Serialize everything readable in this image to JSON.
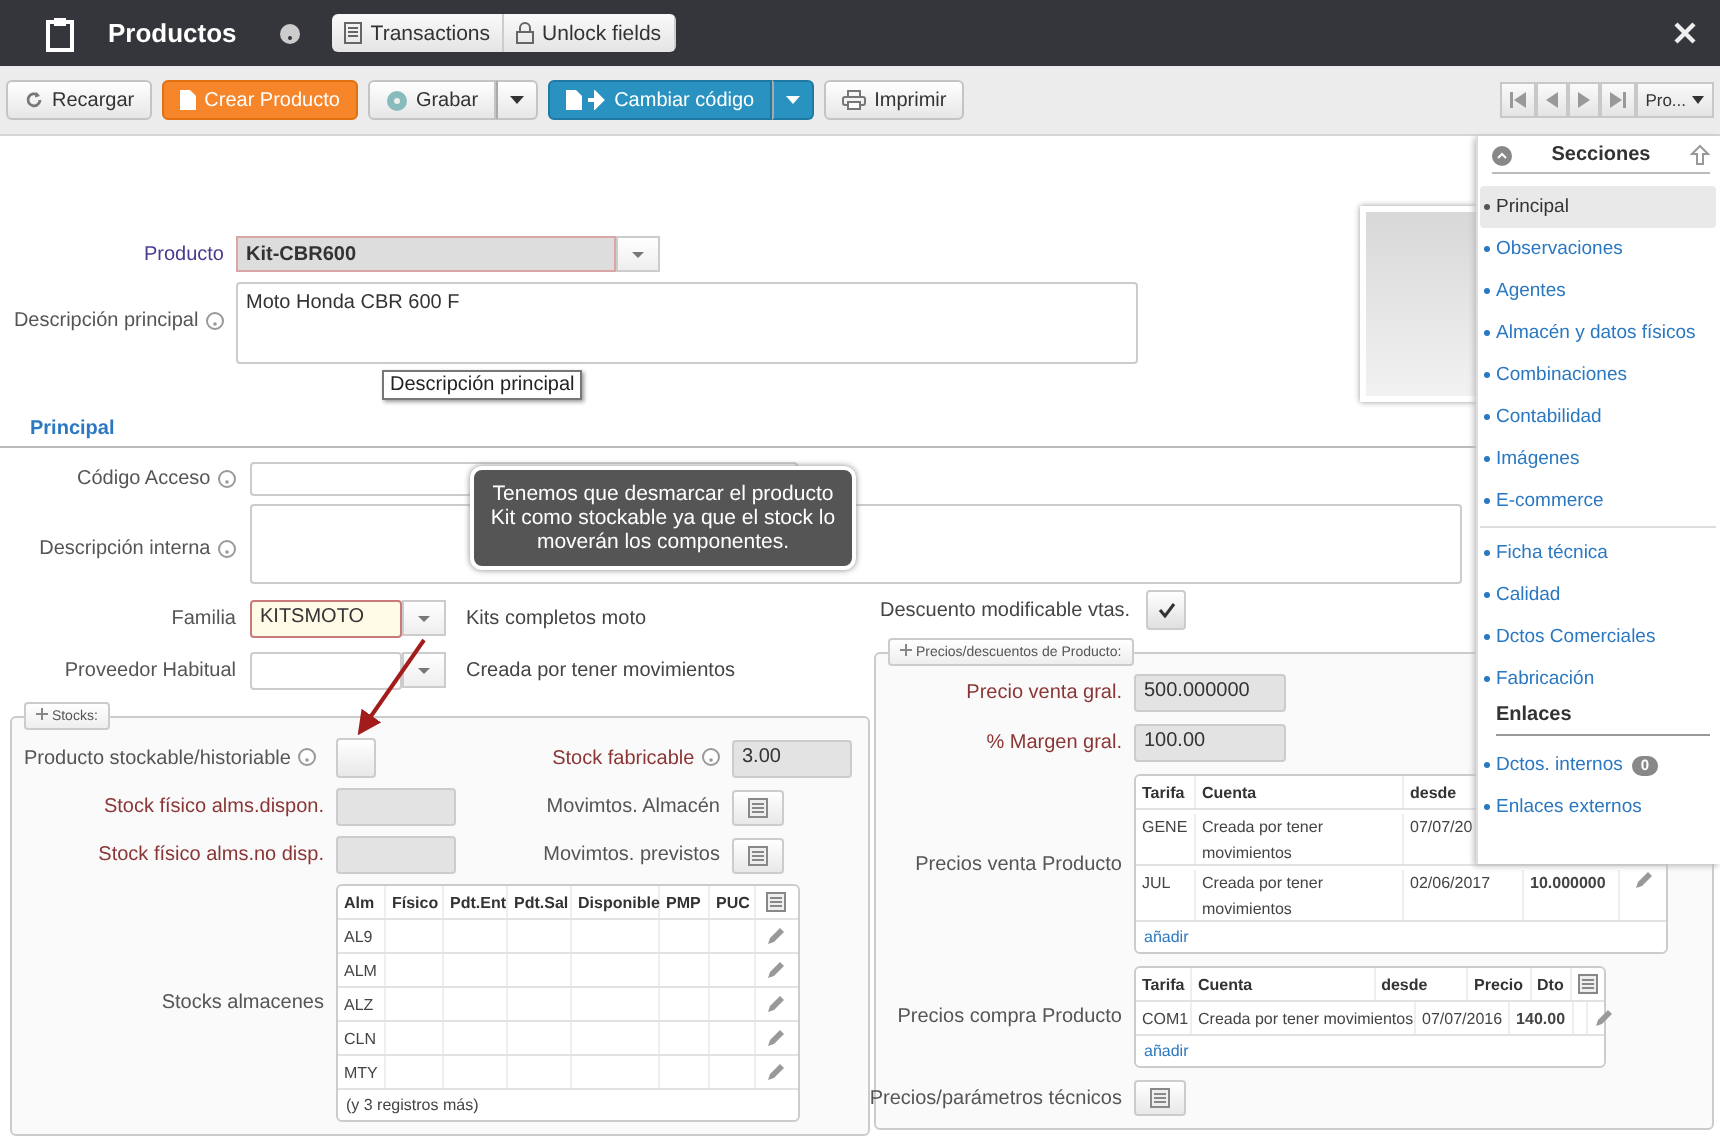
{
  "header": {
    "title": "Productos",
    "actions": [
      {
        "label": "Transactions"
      },
      {
        "label": "Unlock fields"
      }
    ]
  },
  "toolbar": {
    "buttons": [
      {
        "label": "Recargar",
        "kind": "plain"
      },
      {
        "label": "Crear Producto",
        "kind": "primary"
      },
      {
        "label": "Grabar",
        "kind": "split"
      },
      {
        "label": "Cambiar código",
        "kind": "split-blue"
      },
      {
        "label": "Imprimir",
        "kind": "plain"
      }
    ],
    "record_menu": "Pro..."
  },
  "product": {
    "label": "Producto",
    "value": "Kit-CBR600"
  },
  "main_description": {
    "label": "Descripción principal",
    "value": "Moto Honda CBR 600 F",
    "tooltip": "Descripción principal"
  },
  "section_title": "Principal",
  "access_code": {
    "label": "Código Acceso"
  },
  "internal_description": {
    "label": "Descripción interna"
  },
  "family": {
    "label": "Familia",
    "value": "KITSMOTO",
    "description": "Kits completos moto"
  },
  "supplier": {
    "label": "Proveedor Habitual",
    "description": "Creada por tener movimientos"
  },
  "discount_editable": {
    "label": "Descuento modificable vtas.",
    "checked": true
  },
  "callout": {
    "text": "Tenemos que desmarcar el producto Kit como stockable ya que el stock lo moverán los componentes."
  },
  "stocks": {
    "legend": "Stocks:",
    "stockable": {
      "label": "Producto stockable/historiable",
      "checked": false
    },
    "fabricable": {
      "label": "Stock fabricable",
      "value": "3.00"
    },
    "available": {
      "label": "Stock físico alms.dispon."
    },
    "warehouse_moves": {
      "label": "Movimtos. Almacén"
    },
    "unavailable": {
      "label": "Stock físico alms.no disp."
    },
    "planned_moves": {
      "label": "Movimtos. previstos"
    },
    "warehouses": {
      "label": "Stocks almacenes",
      "columns": [
        "Alm",
        "Físico",
        "Pdt.Ent",
        "Pdt.Sal",
        "Disponible",
        "PMP",
        "PUC"
      ],
      "rows": [
        "AL9",
        "ALM",
        "ALZ",
        "CLN",
        "MTY"
      ],
      "more": "(y 3 registros más)"
    }
  },
  "prices": {
    "legend": "Precios/descuentos de Producto:",
    "sale_price": {
      "label": "Precio venta gral.",
      "value": "500.000000"
    },
    "margin": {
      "label": "% Margen gral.",
      "value": "100.00"
    },
    "sales": {
      "label": "Precios venta Producto",
      "columns": [
        "Tarifa",
        "Cuenta",
        "desde"
      ],
      "rows": [
        [
          "GENE",
          "Creada por tener movimientos",
          "07/07/20"
        ],
        [
          "JUL",
          "Creada por tener movimientos",
          "02/06/2017",
          "10.000000"
        ]
      ],
      "add": "añadir"
    },
    "purchases": {
      "label": "Precios compra Producto",
      "columns": [
        "Tarifa",
        "Cuenta",
        "desde",
        "Precio",
        "Dto"
      ],
      "rows": [
        [
          "COM1",
          "Creada por tener movimientos",
          "07/07/2016",
          "140.00"
        ]
      ],
      "add": "añadir"
    },
    "technical": {
      "label": "Precios/parámetros técnicos"
    }
  },
  "sections": {
    "title": "Secciones",
    "groups": [
      {
        "items": [
          {
            "label": "Principal",
            "selected": true
          },
          {
            "label": "Observaciones",
            "selected": false
          },
          {
            "label": "Agentes",
            "selected": false
          },
          {
            "label": "Almacén y datos físicos",
            "selected": false
          },
          {
            "label": "Combinaciones",
            "selected": false
          },
          {
            "label": "Contabilidad",
            "selected": false
          },
          {
            "label": "Imágenes",
            "selected": false
          },
          {
            "label": "E-commerce",
            "selected": false
          }
        ]
      },
      {
        "items": [
          {
            "label": "Ficha técnica",
            "selected": false
          },
          {
            "label": "Calidad",
            "selected": false
          },
          {
            "label": "Dctos Comerciales",
            "selected": false
          },
          {
            "label": "Fabricación",
            "selected": false
          }
        ]
      }
    ],
    "links_title": "Enlaces",
    "links": [
      {
        "label": "Dctos. internos",
        "badge": "0"
      },
      {
        "label": "Enlaces externos"
      }
    ]
  }
}
